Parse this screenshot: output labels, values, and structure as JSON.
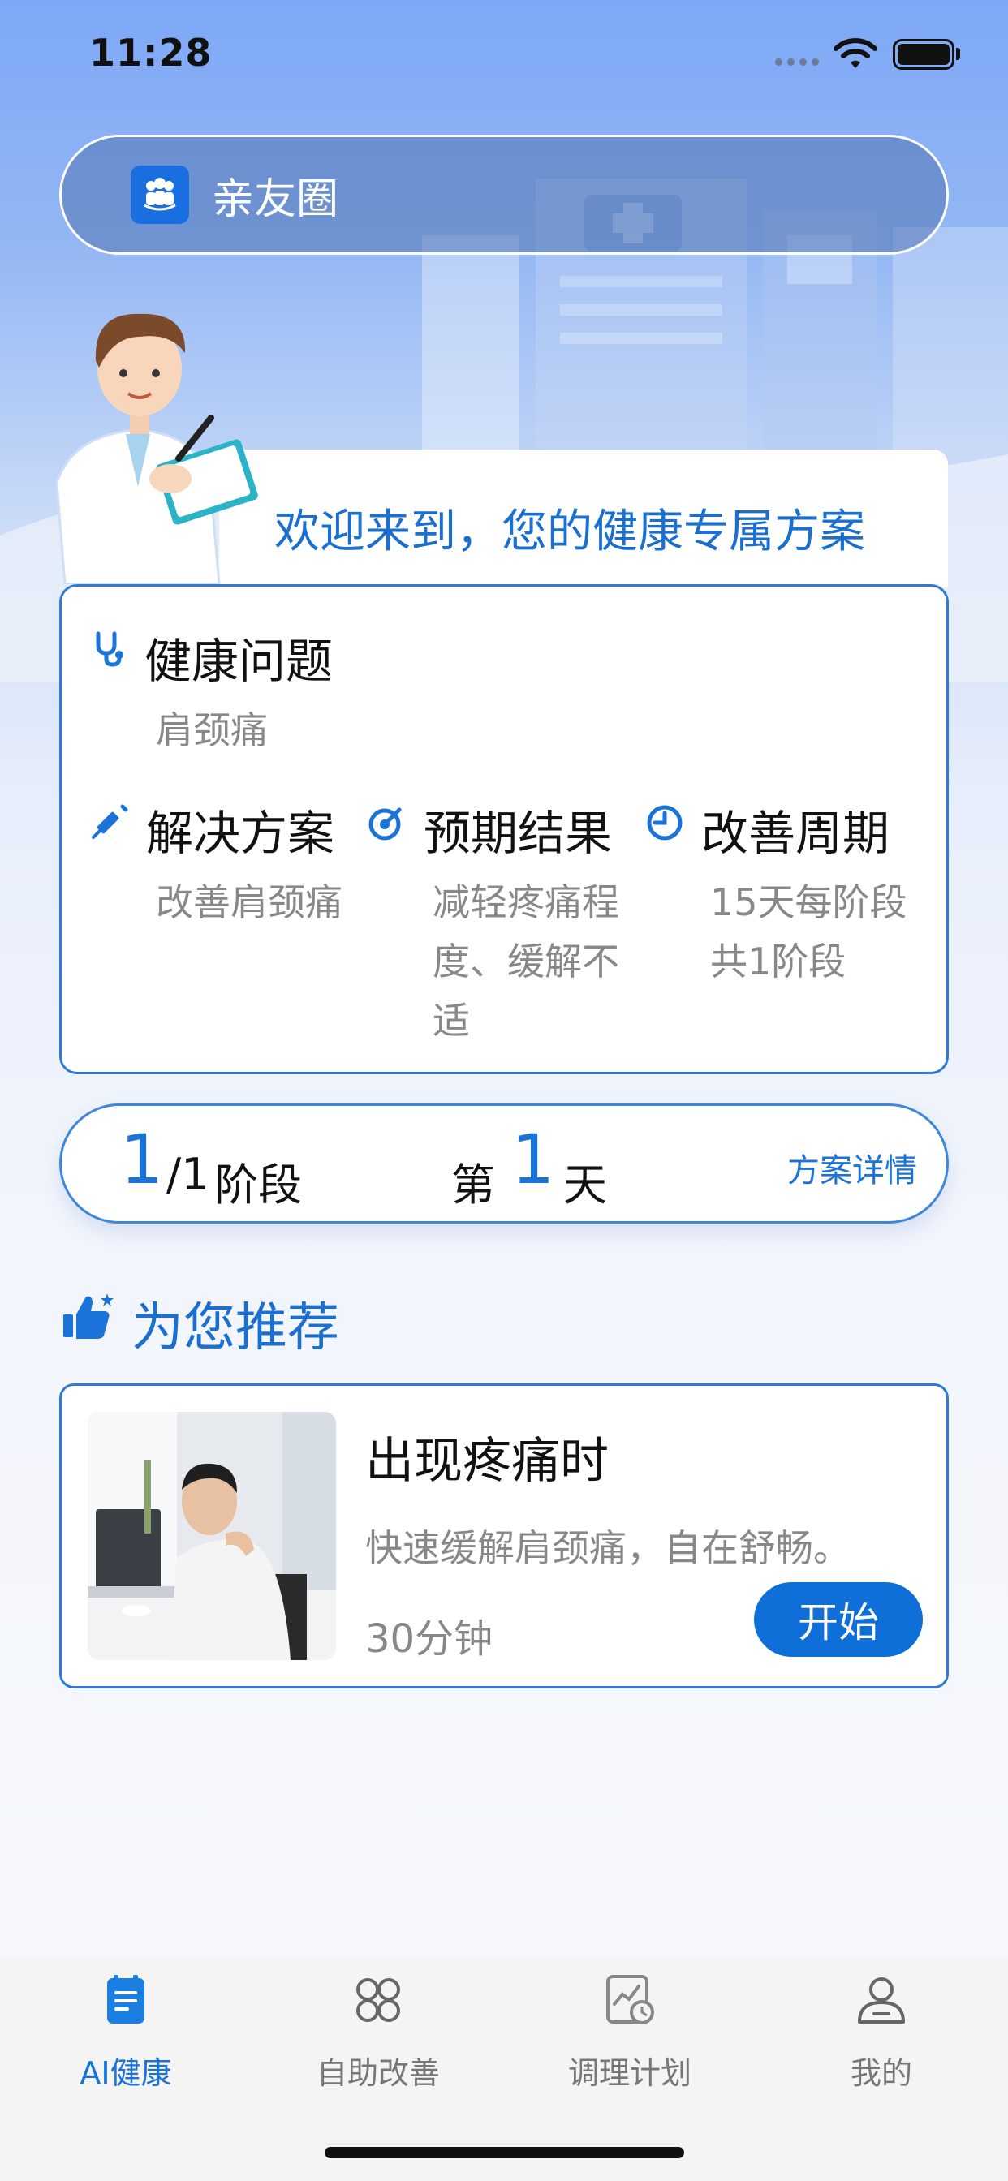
{
  "status_bar": {
    "time": "11:28"
  },
  "circle": {
    "label": "亲友圈"
  },
  "welcome": {
    "text": "欢迎来到，您的健康专属方案"
  },
  "plan": {
    "problem": {
      "title": "健康问题",
      "value": "肩颈痛"
    },
    "solution": {
      "title": "解决方案",
      "value": "改善肩颈痛"
    },
    "expected": {
      "title": "预期结果",
      "value": "减轻疼痛程度、缓解不适"
    },
    "period": {
      "title": "改善周期",
      "value": "15天每阶段共1阶段"
    }
  },
  "stage": {
    "current": "1",
    "total": "/1",
    "unit": "阶段",
    "day_prefix": "第",
    "day": "1",
    "day_suffix": "天",
    "detail_label": "方案详情"
  },
  "recommend": {
    "title": "为您推荐",
    "items": [
      {
        "name": "出现疼痛时",
        "desc": "快速缓解肩颈痛，自在舒畅。",
        "duration": "30分钟",
        "action": "开始"
      }
    ]
  },
  "tabbar": {
    "items": [
      {
        "label": "AI健康",
        "icon": "document-icon",
        "active": true
      },
      {
        "label": "自助改善",
        "icon": "grid-icon",
        "active": false
      },
      {
        "label": "调理计划",
        "icon": "chart-clock-icon",
        "active": false
      },
      {
        "label": "我的",
        "icon": "user-icon",
        "active": false
      }
    ]
  },
  "colors": {
    "accent": "#1a73d9",
    "border": "#2f7ad6",
    "muted": "#888888"
  }
}
